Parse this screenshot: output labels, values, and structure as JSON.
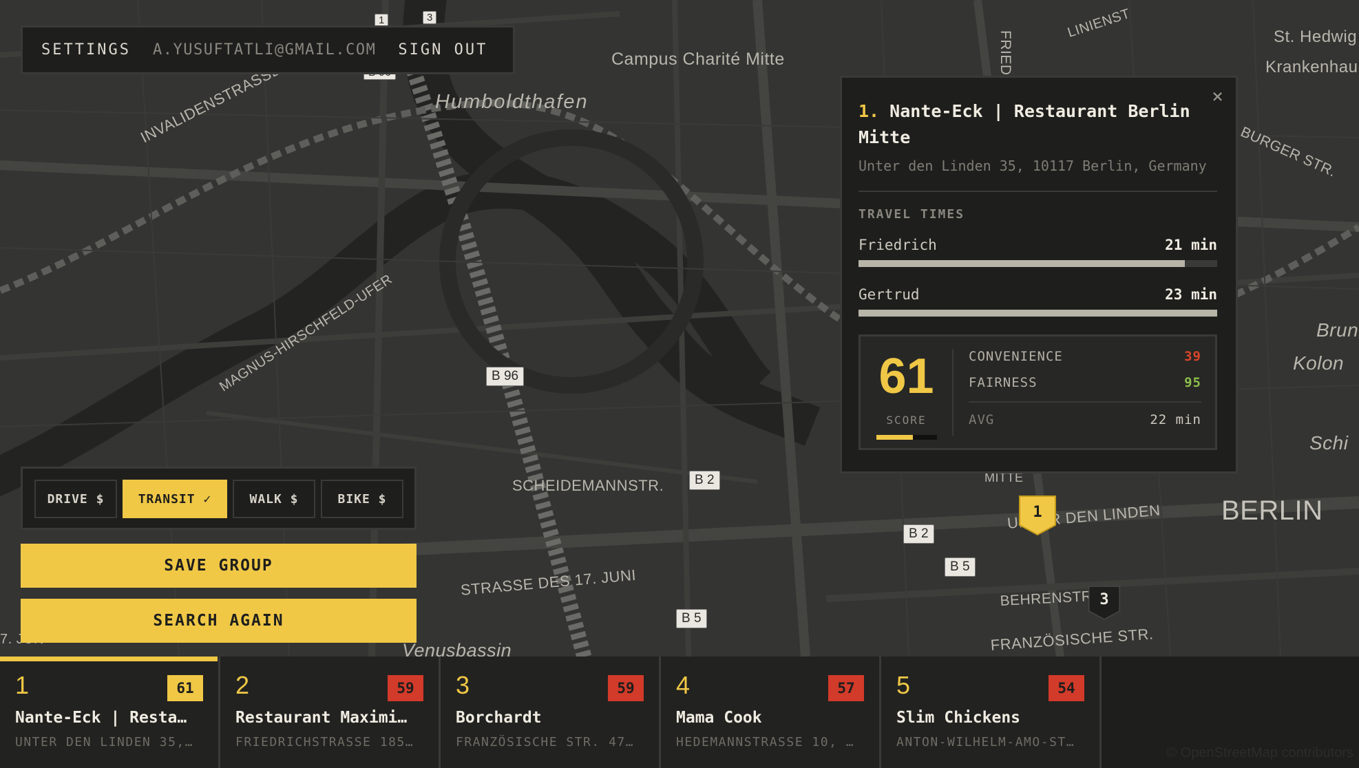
{
  "account": {
    "settings": "SETTINGS",
    "email": "A.YUSUFTATLI@GMAIL.COM",
    "sign_out": "SIGN OUT"
  },
  "map": {
    "labels": {
      "campus": "Campus Charité Mitte",
      "humboldthafen": "Humboldthafen",
      "invalidenstrasse": "INVALIDENSTRASSE",
      "magnus": "MAGNUS-HIRSCHFELD-UFER",
      "scheidemann": "SCHEIDEMANNSTR.",
      "strasse17": "STRASSE DES 17. JUNI",
      "unterdenlinden": "UNTER DEN LINDEN",
      "behrenstr": "BEHRENSTR",
      "franzoesische": "FRANZÖSISCHE STR.",
      "berlin": "BERLIN",
      "hedwig": "St. Hedwig",
      "krankenhaus": "Krankenhau",
      "burgerstr": "BURGER STR.",
      "brun": "Brun",
      "kolon": "Kolon",
      "schi": "Schi",
      "linien": "LINIENST",
      "fried": "FRIED",
      "venus": "Venusbassin",
      "juni_left": "7. JUN",
      "mitte": "MITTE"
    },
    "shields": {
      "b96_top": "B 96",
      "b96": "B 96",
      "b2_a": "B 2",
      "b2_b": "B 2",
      "b5_a": "B 5",
      "b5_b": "B 5",
      "top1": "1",
      "top3": "3"
    },
    "pins": {
      "selected": "1",
      "other": "3"
    }
  },
  "modes": [
    {
      "label": "DRIVE $",
      "active": false
    },
    {
      "label": "TRANSIT ✓",
      "active": true
    },
    {
      "label": "WALK $",
      "active": false
    },
    {
      "label": "BIKE $",
      "active": false
    }
  ],
  "actions": {
    "save_group": "SAVE GROUP",
    "search_again": "SEARCH AGAIN"
  },
  "popup": {
    "rank": "1.",
    "title": "Nante-Eck | Restaurant Berlin Mitte",
    "address": "Unter den Linden 35, 10117 Berlin, Germany",
    "close": "×",
    "travel_times_label": "TRAVEL TIMES",
    "travel_times": [
      {
        "name": "Friedrich",
        "time": "21 min",
        "fraction": 0.91
      },
      {
        "name": "Gertrud",
        "time": "23 min",
        "fraction": 1.0
      }
    ],
    "score": "61",
    "score_label": "SCORE",
    "score_fraction": 0.61,
    "metrics": {
      "convenience_label": "CONVENIENCE",
      "convenience": "39",
      "convenience_color": "#d9452b",
      "fairness_label": "FAIRNESS",
      "fairness": "95",
      "fairness_color": "#8bbf4a",
      "avg_label": "AVG",
      "avg": "22 min"
    }
  },
  "results": [
    {
      "rank": "1",
      "score": "61",
      "name": "Nante-Eck | Resta…",
      "address": "UNTER DEN LINDEN 35,…",
      "active": true,
      "badge_color": "#f0c846"
    },
    {
      "rank": "2",
      "score": "59",
      "name": "Restaurant Maximi…",
      "address": "FRIEDRICHSTRASSE 185…",
      "active": false,
      "badge_color": "#d23a2a"
    },
    {
      "rank": "3",
      "score": "59",
      "name": "Borchardt",
      "address": "FRANZÖSISCHE STR. 47…",
      "active": false,
      "badge_color": "#d23a2a"
    },
    {
      "rank": "4",
      "score": "57",
      "name": "Mama Cook",
      "address": "HEDEMANNSTRASSE 10, …",
      "active": false,
      "badge_color": "#d23a2a"
    },
    {
      "rank": "5",
      "score": "54",
      "name": "Slim Chickens",
      "address": "ANTON-WILHELM-AMO-ST…",
      "active": false,
      "badge_color": "#d23a2a"
    }
  ],
  "attribution": "© OpenStreetMap contributors",
  "colors": {
    "accent": "#f0c846",
    "background": "#1e1e1c",
    "map": "#343432"
  }
}
